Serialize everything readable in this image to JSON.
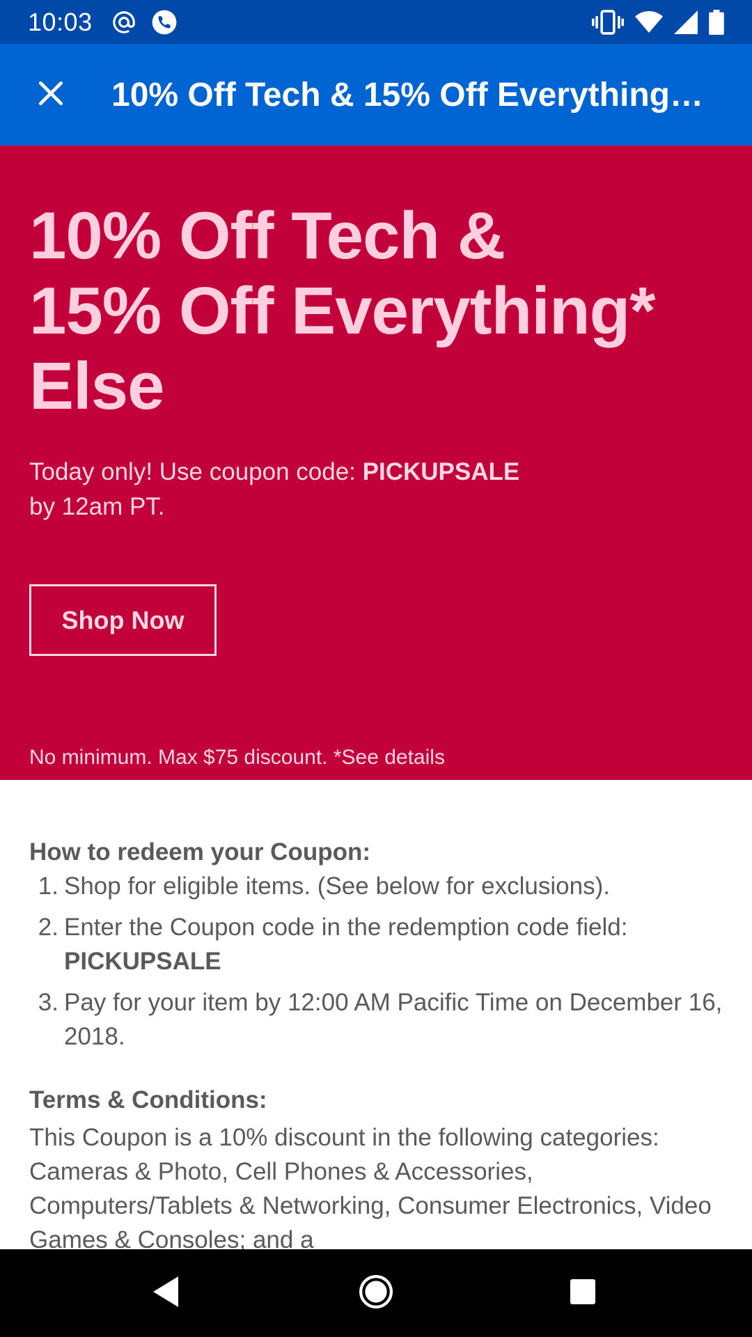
{
  "status_bar": {
    "time": "10:03",
    "left_icons": [
      "at-sign-icon",
      "phone-call-icon"
    ],
    "right_icons": [
      "vibrate-icon",
      "wifi-icon",
      "cell-signal-icon",
      "battery-icon"
    ]
  },
  "app_bar": {
    "close_icon": "close-icon",
    "title": "10% Off Tech & 15% Off Everything…"
  },
  "hero": {
    "headline_line1": "10% Off Tech &",
    "headline_line2": "15% Off Everything*",
    "headline_line3": "Else",
    "sub_prefix": "Today only! Use coupon code: ",
    "sub_code": "PICKUPSALE",
    "sub_suffix": "by 12am PT.",
    "shop_button": "Shop Now",
    "fine_print": "No minimum. Max $75 discount. *See details",
    "bg_color": "#c2003a"
  },
  "details": {
    "redeem_title": "How to redeem your Coupon:",
    "steps": [
      {
        "num": "1.",
        "text": "Shop for eligible items. (See below for exclusions)."
      },
      {
        "num": "2.",
        "text": "Enter the Coupon code in the redemption code field:",
        "code": "PICKUPSALE"
      },
      {
        "num": "3.",
        "text": "Pay for your item by 12:00 AM Pacific Time on December 16, 2018."
      }
    ],
    "terms_title": "Terms & Conditions:",
    "terms_body": "This Coupon is a 10% discount in the following categories: Cameras & Photo, Cell Phones & Accessories, Computers/Tablets & Networking, Consumer Electronics, Video Games & Consoles; and a"
  },
  "nav_bar": {
    "back_icon": "back-triangle-icon",
    "home_icon": "home-circle-icon",
    "recents_icon": "recents-square-icon"
  },
  "colors": {
    "status_bar": "#0049a8",
    "app_bar": "#0064d2",
    "hero": "#c2003a",
    "hero_text": "#ffd6e3"
  }
}
